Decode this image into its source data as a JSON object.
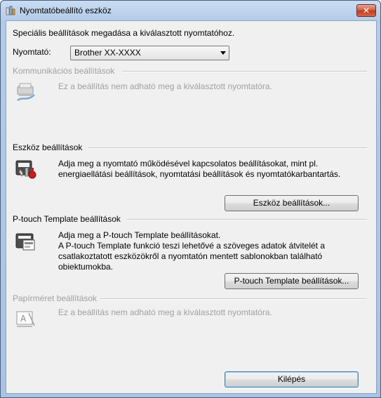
{
  "window": {
    "title": "Nyomtatóbeállító eszköz",
    "close_label": "✕"
  },
  "intro": "Speciális beállítások megadása a kiválasztott nyomtatóhoz.",
  "printer": {
    "label": "Nyomtató:",
    "selected": "Brother XX-XXXX"
  },
  "sections": {
    "communication": {
      "heading": "Kommunikációs beállítások",
      "description": "Ez a beállítás nem adható meg a kiválasztott nyomtatóra.",
      "icon": "communication-settings-icon"
    },
    "device": {
      "heading": "Eszköz beállítások",
      "description_line1": "Adja meg a nyomtató működésével kapcsolatos beállításokat, mint pl.",
      "description_line2": "energiaellátási beállítások, nyomtatási beállítások és nyomtatókarbantartás.",
      "button_label": "Eszköz beállítások...",
      "icon": "device-settings-icon"
    },
    "ptouch": {
      "heading": "P-touch Template beállítások",
      "description_line1": "Adja meg a P-touch Template beállításokat.",
      "description_line2": "A P-touch Template funkció teszi lehetővé a szöveges adatok átvitelét a",
      "description_line3": "csatlakoztatott eszközökről a nyomtatón mentett sablonokban található",
      "description_line4": "obiektumokba.",
      "button_label": "P-touch Template beállítások...",
      "icon": "ptouch-template-icon"
    },
    "paper": {
      "heading": "Papírméret beállítások",
      "description": "Ez a beállítás nem adható meg a kiválasztott nyomtatóra.",
      "icon": "paper-size-icon"
    }
  },
  "exit_button": "Kilépés",
  "colors": {
    "title_gradient_top": "#c9dcf2",
    "client_bg": "#f0f0f0",
    "disabled_text": "#a0a0a0",
    "close_red": "#c2381c"
  }
}
